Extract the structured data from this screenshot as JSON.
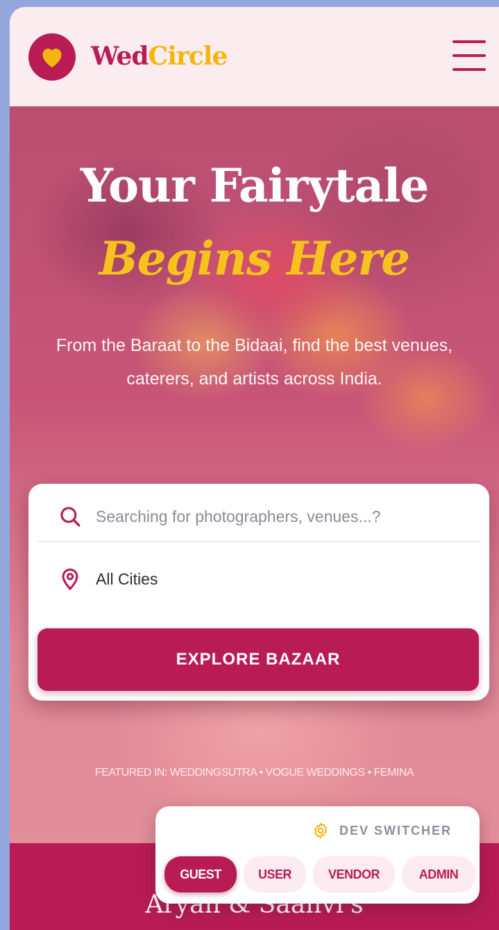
{
  "header": {
    "brand_part1": "Wed",
    "brand_part2": "Circle",
    "logo_icon": "heart-icon",
    "menu_icon": "hamburger-menu-icon"
  },
  "hero": {
    "title_line1": "Your Fairytale",
    "title_line2": "Begins Here",
    "subtitle": "From the Baraat to the Bidaai, find the best venues, caterers, and artists across India."
  },
  "search": {
    "placeholder": "Searching for photographers, venues...?",
    "city": "All Cities",
    "button_label": "EXPLORE BAZAAR"
  },
  "featured": "FEATURED IN: WEDDINGSUTRA • VOGUE WEDDINGS • FEMINA",
  "band": {
    "title": "Aryan & Saanvi's"
  },
  "dev_switcher": {
    "label": "DEV SWITCHER",
    "roles": [
      {
        "label": "GUEST",
        "active": true
      },
      {
        "label": "USER",
        "active": false
      },
      {
        "label": "VENDOR",
        "active": false
      },
      {
        "label": "ADMIN",
        "active": false
      }
    ]
  },
  "colors": {
    "brand_primary": "#b91c55",
    "brand_accent": "#f5b50f",
    "header_bg": "#fbecf0",
    "page_bg": "#93a6de"
  }
}
